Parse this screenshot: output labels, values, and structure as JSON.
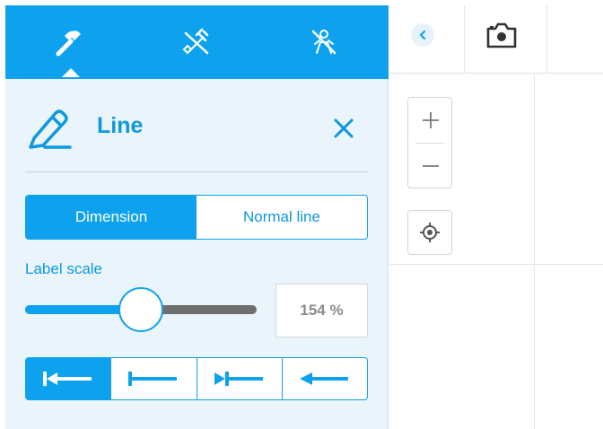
{
  "toolbar": {
    "tabs": [
      {
        "icon": "hammer-icon",
        "active": true
      },
      {
        "icon": "eraser-icon",
        "active": false
      },
      {
        "icon": "hide-person-icon",
        "active": false
      }
    ]
  },
  "panel": {
    "title": "Line",
    "title_icon": "pencil-icon",
    "close_icon": "close-icon"
  },
  "mode_toggle": {
    "options": [
      "Dimension",
      "Normal line"
    ],
    "selected": "Dimension"
  },
  "label_scale": {
    "label": "Label scale",
    "value": 154,
    "value_text": "154 %",
    "slider_fraction": 0.5
  },
  "arrow_styles": {
    "options": [
      "bar-arrow-icon",
      "bar-icon",
      "filled-arrow-bar-icon",
      "arrow-icon"
    ],
    "selected_index": 0
  },
  "canvas": {
    "collapse_icon": "chevron-left-icon",
    "camera_icon": "camera-icon",
    "zoom_in_icon": "plus-icon",
    "zoom_out_icon": "minus-icon",
    "locate_icon": "crosshair-icon"
  },
  "colors": {
    "accent": "#0ea2ee",
    "panel_bg": "#e9f4fb",
    "slider_track": "#6e6e6e"
  }
}
